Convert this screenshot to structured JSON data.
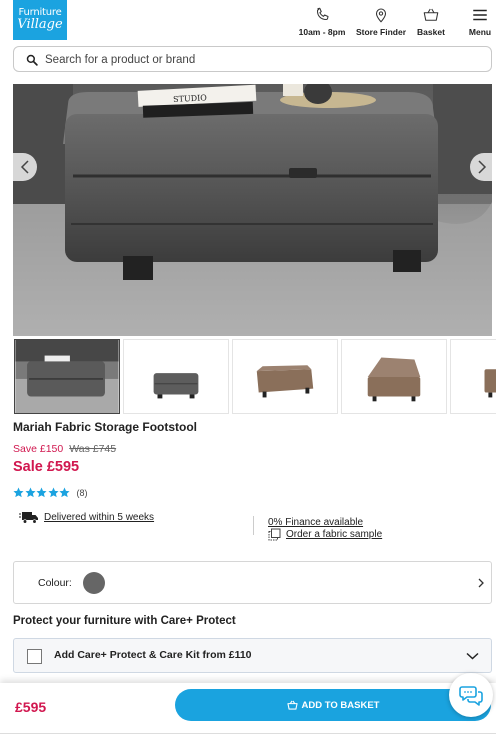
{
  "brand": {
    "logo_line1": "Furniture",
    "logo_line2": "Village",
    "accent": "#1ba3e0",
    "sale_color": "#d1174f"
  },
  "header": {
    "nav": [
      {
        "label": "10am - 8pm",
        "icon": "phone-icon"
      },
      {
        "label": "Store Finder",
        "icon": "location-pin-icon"
      },
      {
        "label": "Basket",
        "icon": "basket-icon"
      },
      {
        "label": "Menu",
        "icon": "hamburger-menu-icon"
      }
    ]
  },
  "search": {
    "placeholder": "Search for a product or brand",
    "value": ""
  },
  "gallery": {
    "main_image_book_text": "STUDIO",
    "thumbnail_count": 5,
    "active_index": 0
  },
  "product": {
    "title": "Mariah Fabric Storage Footstool",
    "save_text": "Save £150",
    "was_text": "Was £745",
    "sale_text": "Sale £595",
    "rating_stars": 5,
    "rating_count": "(8)"
  },
  "info": {
    "delivery": "Delivered within 5 weeks",
    "finance": "0% Finance available",
    "sample": "Order a fabric sample"
  },
  "colour": {
    "label": "Colour:",
    "swatch": "#666666"
  },
  "protect": {
    "title": "Protect your furniture with Care+ Protect",
    "option_label": "Add Care+ Protect & Care Kit from £110",
    "checked": false
  },
  "sticky": {
    "price": "£595",
    "button_label": "ADD TO BASKET"
  }
}
